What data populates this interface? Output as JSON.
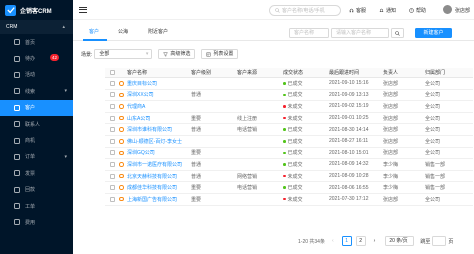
{
  "app": {
    "name": "企销客CRM"
  },
  "sidebar": {
    "group_label": "CRM",
    "items": [
      {
        "label": "首页",
        "icon": "home-icon"
      },
      {
        "label": "待办",
        "icon": "todo-icon",
        "badge": "42"
      },
      {
        "label": "活动",
        "icon": "activity-icon"
      },
      {
        "label": "线索",
        "icon": "lead-icon",
        "has_children": true
      },
      {
        "label": "客户",
        "icon": "customer-icon",
        "active": true
      },
      {
        "label": "联系人",
        "icon": "contact-icon"
      },
      {
        "label": "商机",
        "icon": "opportunity-icon"
      },
      {
        "label": "订单",
        "icon": "order-icon",
        "has_children": true
      },
      {
        "label": "发票",
        "icon": "invoice-icon"
      },
      {
        "label": "回款",
        "icon": "payment-icon"
      },
      {
        "label": "工单",
        "icon": "ticket-icon"
      },
      {
        "label": "费用",
        "icon": "expense-icon"
      }
    ]
  },
  "topbar": {
    "search_placeholder": "客户名称/电话/手机",
    "links": [
      {
        "label": "客服",
        "icon": "headset-icon"
      },
      {
        "label": "通知",
        "icon": "bell-icon"
      },
      {
        "label": "帮助",
        "icon": "help-icon"
      }
    ],
    "user_name": "张店部"
  },
  "tabs": [
    {
      "label": "客户",
      "active": true
    },
    {
      "label": "公海",
      "active": false
    },
    {
      "label": "附近客户",
      "active": false
    }
  ],
  "filters": {
    "select_placeholder": "客户名称",
    "input_placeholder": "请输入客户名称",
    "new_button": "新建客户"
  },
  "toolbar": {
    "scene_label": "场景:",
    "scene_value": "全部",
    "advanced_filter": "高级筛选",
    "column_settings": "列表设置"
  },
  "table": {
    "headers": [
      "客户名称",
      "客户级别",
      "客户来源",
      "成交状态",
      "最后跟进时间",
      "负责人",
      "归属部门"
    ],
    "rows": [
      {
        "name": "重庆目标公司",
        "level": "",
        "source": "",
        "status": "已成交",
        "status_color": "#52c41a",
        "time": "2021-09-10 15:16",
        "owner": "张店部",
        "dept": "全公司"
      },
      {
        "name": "深圳XX公司",
        "level": "普通",
        "source": "",
        "status": "已成交",
        "status_color": "#52c41a",
        "time": "2021-09-09 13:13",
        "owner": "张店部",
        "dept": "全公司"
      },
      {
        "name": "代理商A",
        "level": "",
        "source": "",
        "status": "未成交",
        "status_color": "#f5222d",
        "time": "2021-09-02 15:19",
        "owner": "张店部",
        "dept": "全公司"
      },
      {
        "name": "山东A公司",
        "level": "重要",
        "source": "线上注册",
        "status": "未成交",
        "status_color": "#f5222d",
        "time": "2021-09-01 10:25",
        "owner": "张店部",
        "dept": "全公司"
      },
      {
        "name": "深圳市谁科有限公司",
        "level": "普通",
        "source": "电话营销",
        "status": "已成交",
        "status_color": "#52c41a",
        "time": "2021-08-30 14:14",
        "owner": "张店部",
        "dept": "全公司"
      },
      {
        "name": "佛山-顺德区-百灯-李女士",
        "level": "",
        "source": "",
        "status": "已成交",
        "status_color": "#52c41a",
        "time": "2021-08-27 16:11",
        "owner": "张店部",
        "dept": "全公司"
      },
      {
        "name": "深圳GQ公司",
        "level": "重要",
        "source": "",
        "status": "已成交",
        "status_color": "#52c41a",
        "time": "2021-08-10 15:01",
        "owner": "张店部",
        "dept": "全公司"
      },
      {
        "name": "深圳市一诺医疗有限公司",
        "level": "普通",
        "source": "",
        "status": "已成交",
        "status_color": "#52c41a",
        "time": "2021-08-09 14:32",
        "owner": "李少梅",
        "dept": "销售一部"
      },
      {
        "name": "北京天赫科技有限公司",
        "level": "普通",
        "source": "网络营销",
        "status": "未成交",
        "status_color": "#f5222d",
        "time": "2021-08-09 10:28",
        "owner": "李少梅",
        "dept": "销售一部"
      },
      {
        "name": "成都佳华科技有限公司",
        "level": "重要",
        "source": "电话营销",
        "status": "已成交",
        "status_color": "#52c41a",
        "time": "2021-08-06 16:55",
        "owner": "李少梅",
        "dept": "销售一部"
      },
      {
        "name": "上海新国广告有限公司",
        "level": "重要",
        "source": "",
        "status": "未成交",
        "status_color": "#f5222d",
        "time": "2021-07-30 17:12",
        "owner": "张店部",
        "dept": "全公司"
      }
    ]
  },
  "pagination": {
    "total_text": "1-20 共34条",
    "prev": "‹",
    "next": "›",
    "pages": [
      "1",
      "2"
    ],
    "current": "1",
    "page_size": "20 条/页",
    "goto_label": "跳至",
    "goto_value": "",
    "page_suffix": "页"
  },
  "colors": {
    "primary": "#1890ff",
    "sidebar_bg": "#001529",
    "success": "#52c41a",
    "danger": "#f5222d"
  }
}
